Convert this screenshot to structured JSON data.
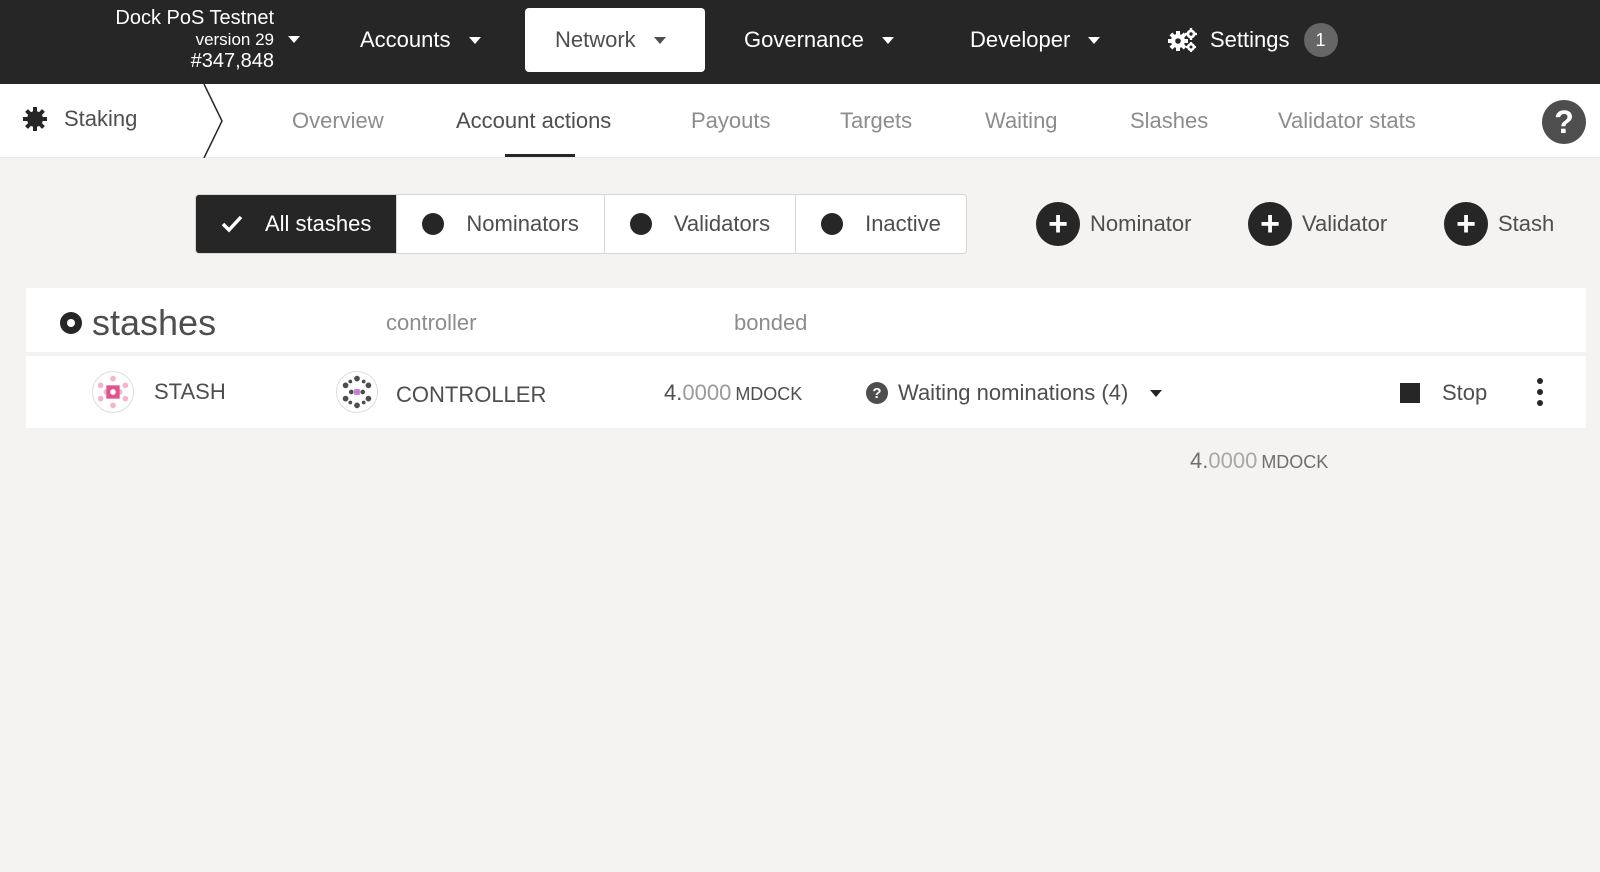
{
  "header": {
    "chain_name": "Dock PoS Testnet",
    "version": "version 29",
    "block": "#347,848",
    "nav": [
      {
        "label": "Accounts"
      },
      {
        "label": "Network"
      },
      {
        "label": "Governance"
      },
      {
        "label": "Developer"
      },
      {
        "label": "Settings",
        "badge": "1"
      }
    ]
  },
  "subnav": {
    "app": "Staking",
    "tabs": [
      "Overview",
      "Account actions",
      "Payouts",
      "Targets",
      "Waiting",
      "Slashes",
      "Validator stats"
    ],
    "active_tab": "Account actions",
    "help": "?"
  },
  "filters": [
    "All stashes",
    "Nominators",
    "Validators",
    "Inactive"
  ],
  "actions": [
    "Nominator",
    "Validator",
    "Stash"
  ],
  "table": {
    "title": "stashes",
    "col_controller": "controller",
    "col_bonded": "bonded",
    "row": {
      "stash": "STASH",
      "controller": "CONTROLLER",
      "bonded_int": "4.",
      "bonded_dec": "0000",
      "bonded_unit": "MDOCK",
      "status": "Waiting nominations (4)",
      "stop": "Stop"
    },
    "total": {
      "int": "4.",
      "dec": "0000",
      "unit": "MDOCK"
    }
  },
  "colors": {
    "dark": "#262626",
    "bg": "#f5f3f1",
    "identicon_pink": "#e0548c"
  }
}
